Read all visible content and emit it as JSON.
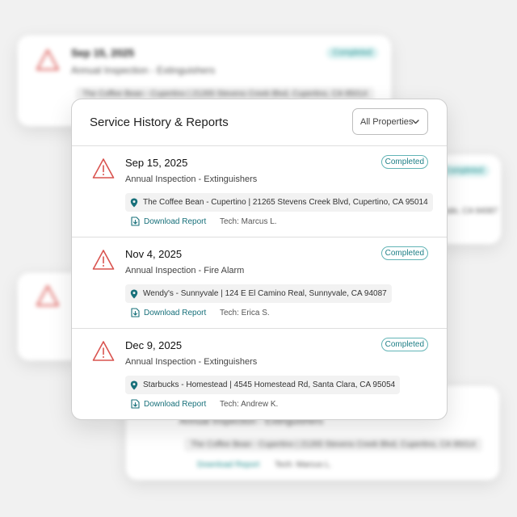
{
  "panel": {
    "title": "Service History & Reports",
    "filter": {
      "selected": "All Properties",
      "icon": "chevron-down-icon"
    }
  },
  "records": [
    {
      "date": "Sep 15, 2025",
      "type": "Annual Inspection - Extinguishers",
      "status": "Completed",
      "location": "The Coffee Bean - Cupertino | 21265 Stevens Creek Blvd, Cupertino, CA 95014",
      "download_label": "Download Report",
      "tech": "Tech: Marcus L."
    },
    {
      "date": "Nov 4, 2025",
      "type": "Annual Inspection - Fire Alarm",
      "status": "Completed",
      "location": "Wendy's - Sunnyvale | 124 E El Camino Real, Sunnyvale, CA 94087",
      "download_label": "Download Report",
      "tech": "Tech: Erica S."
    },
    {
      "date": "Dec 9, 2025",
      "type": "Annual Inspection - Extinguishers",
      "status": "Completed",
      "location": "Starbucks - Homestead | 4545 Homestead Rd, Santa Clara, CA 95054",
      "download_label": "Download Report",
      "tech": "Tech: Andrew K."
    }
  ],
  "background_cards": {
    "top": {
      "date": "Sep 15, 2025",
      "type": "Annual Inspection - Extinguishers",
      "status": "Completed",
      "location": "The Coffee Bean - Cupertino | 21265 Stevens Creek Blvd, Cupertino, CA 95014"
    },
    "bottom": {
      "type": "Annual Inspection - Extinguishers",
      "location": "The Coffee Bean - Cupertino | 21265 Stevens Creek Blvd, Cupertino, CA 95014",
      "download_label": "Download Report",
      "tech": "Tech: Marcus L."
    },
    "right": {
      "status": "Completed",
      "location": "Sunnyvale, CA 94087"
    }
  },
  "colors": {
    "accent": "#1f7f86",
    "alert": "#d9534f",
    "badge_border": "#62b4b6"
  },
  "icons": [
    "alert-triangle-icon",
    "map-pin-icon",
    "download-icon",
    "chevron-down-icon"
  ]
}
